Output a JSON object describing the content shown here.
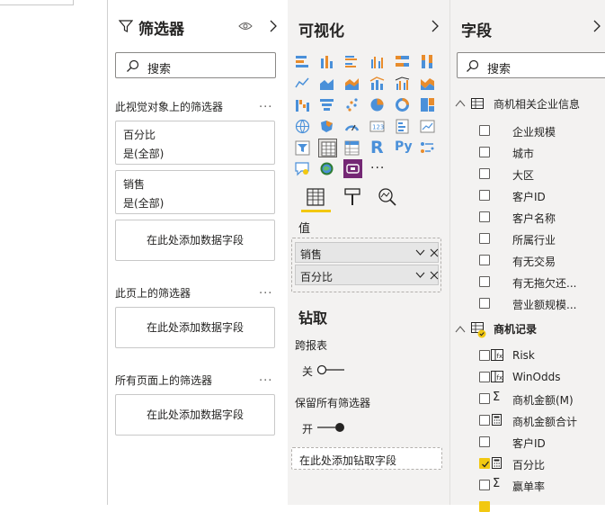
{
  "filters": {
    "title": "筛选器",
    "search_placeholder": "搜索",
    "visual_section": "此视觉对象上的筛选器",
    "cards": [
      {
        "name": "百分比",
        "state": "是(全部)"
      },
      {
        "name": "销售",
        "state": "是(全部)"
      }
    ],
    "add_field": "在此处添加数据字段",
    "page_section": "此页上的筛选器",
    "all_pages_section": "所有页面上的筛选器",
    "more": "..."
  },
  "viz": {
    "title": "可视化",
    "values_label": "值",
    "wells": [
      "销售",
      "百分比"
    ],
    "drill_title": "钻取",
    "cross_report": "跨报表",
    "toggle_off": "关",
    "keep_filters": "保留所有筛选器",
    "toggle_on": "开",
    "drill_add": "在此处添加钻取字段",
    "ellipsis": "...",
    "r_label": "R",
    "py_label": "Py"
  },
  "fields": {
    "title": "字段",
    "search_placeholder": "搜索",
    "tables": [
      {
        "name": "商机相关企业信息",
        "items": [
          "企业规模",
          "城市",
          "大区",
          "客户ID",
          "客户名称",
          "所属行业",
          "有无交易",
          "有无拖欠还...",
          "营业额规模..."
        ]
      },
      {
        "name": "商机记录",
        "items": [
          "Risk",
          "WinOdds",
          "商机金额(M)",
          "商机金额合计",
          "客户ID",
          "百分比",
          "赢单率"
        ]
      }
    ]
  },
  "colors": {
    "accent": "#f2c811",
    "pane_bg": "#f3f2f1"
  }
}
